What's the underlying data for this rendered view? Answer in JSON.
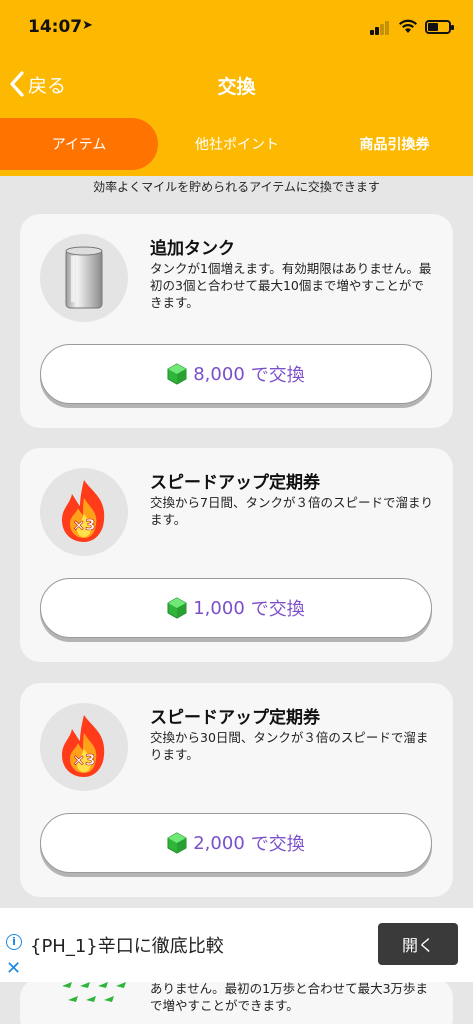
{
  "status": {
    "time": "14:07"
  },
  "nav": {
    "back_label": "戻る",
    "title": "交換"
  },
  "tabs": [
    {
      "label": "アイテム",
      "active": true
    },
    {
      "label": "他社ポイント",
      "active": false
    },
    {
      "label": "商品引換券",
      "active": false
    }
  ],
  "intro": "効率よくマイルを貯められるアイテムに交換できます",
  "items": [
    {
      "title": "追加タンク",
      "desc": "タンクが1個増えます。有効期限はありません。最初の3個と合わせて最大10個まで増やすことができます。",
      "cost": "8,000",
      "btn_suffix": "で交換",
      "icon": "tank-icon"
    },
    {
      "title": "スピードアップ定期券",
      "desc": "交換から7日間、タンクが３倍のスピードで溜まります。",
      "cost": "1,000",
      "btn_suffix": "で交換",
      "icon": "fire-x3-icon"
    },
    {
      "title": "スピードアップ定期券",
      "desc": "交換から30日間、タンクが３倍のスピードで溜まります。",
      "cost": "2,000",
      "btn_suffix": "で交換",
      "icon": "fire-x3-icon"
    }
  ],
  "partial_item": {
    "desc": "ありません。最初の1万歩と合わせて最大3万歩まで増やすことができます。"
  },
  "ad": {
    "text": "{PH_1}辛口に徹底比較",
    "button": "開く"
  },
  "colors": {
    "header": "#fdb902",
    "tab_active": "#ff7400",
    "price_text": "#7b4fc9",
    "gem": "#3fcf4a"
  }
}
